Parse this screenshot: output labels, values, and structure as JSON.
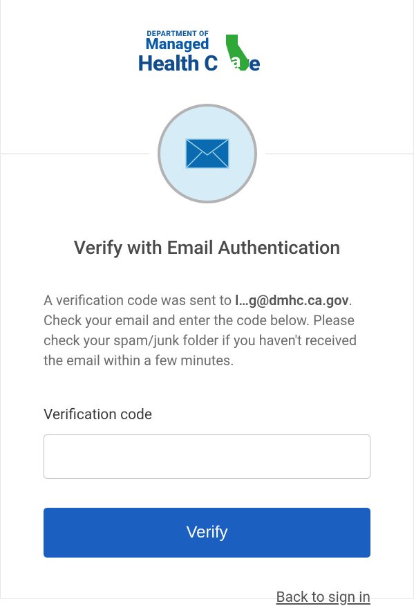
{
  "logo": {
    "line1": "DEPARTMENT OF",
    "line2": "Managed",
    "line3_part1": "Health C",
    "line3_part2": "re",
    "state_letter": "a"
  },
  "title": "Verify with Email Authentication",
  "description": {
    "prefix": "A verification code was sent to ",
    "email": "l…g@dmhc.ca.gov",
    "suffix": ". Check your email and enter the code below. Please check your spam/junk folder if you haven't received the email within a few minutes."
  },
  "field": {
    "label": "Verification code",
    "value": ""
  },
  "buttons": {
    "verify": "Verify",
    "back": "Back to sign in"
  },
  "colors": {
    "primary_button": "#1b5fc1",
    "logo_green": "#2fa838",
    "logo_blue": "#0b5aa6",
    "envelope": "#0b6bb0"
  }
}
